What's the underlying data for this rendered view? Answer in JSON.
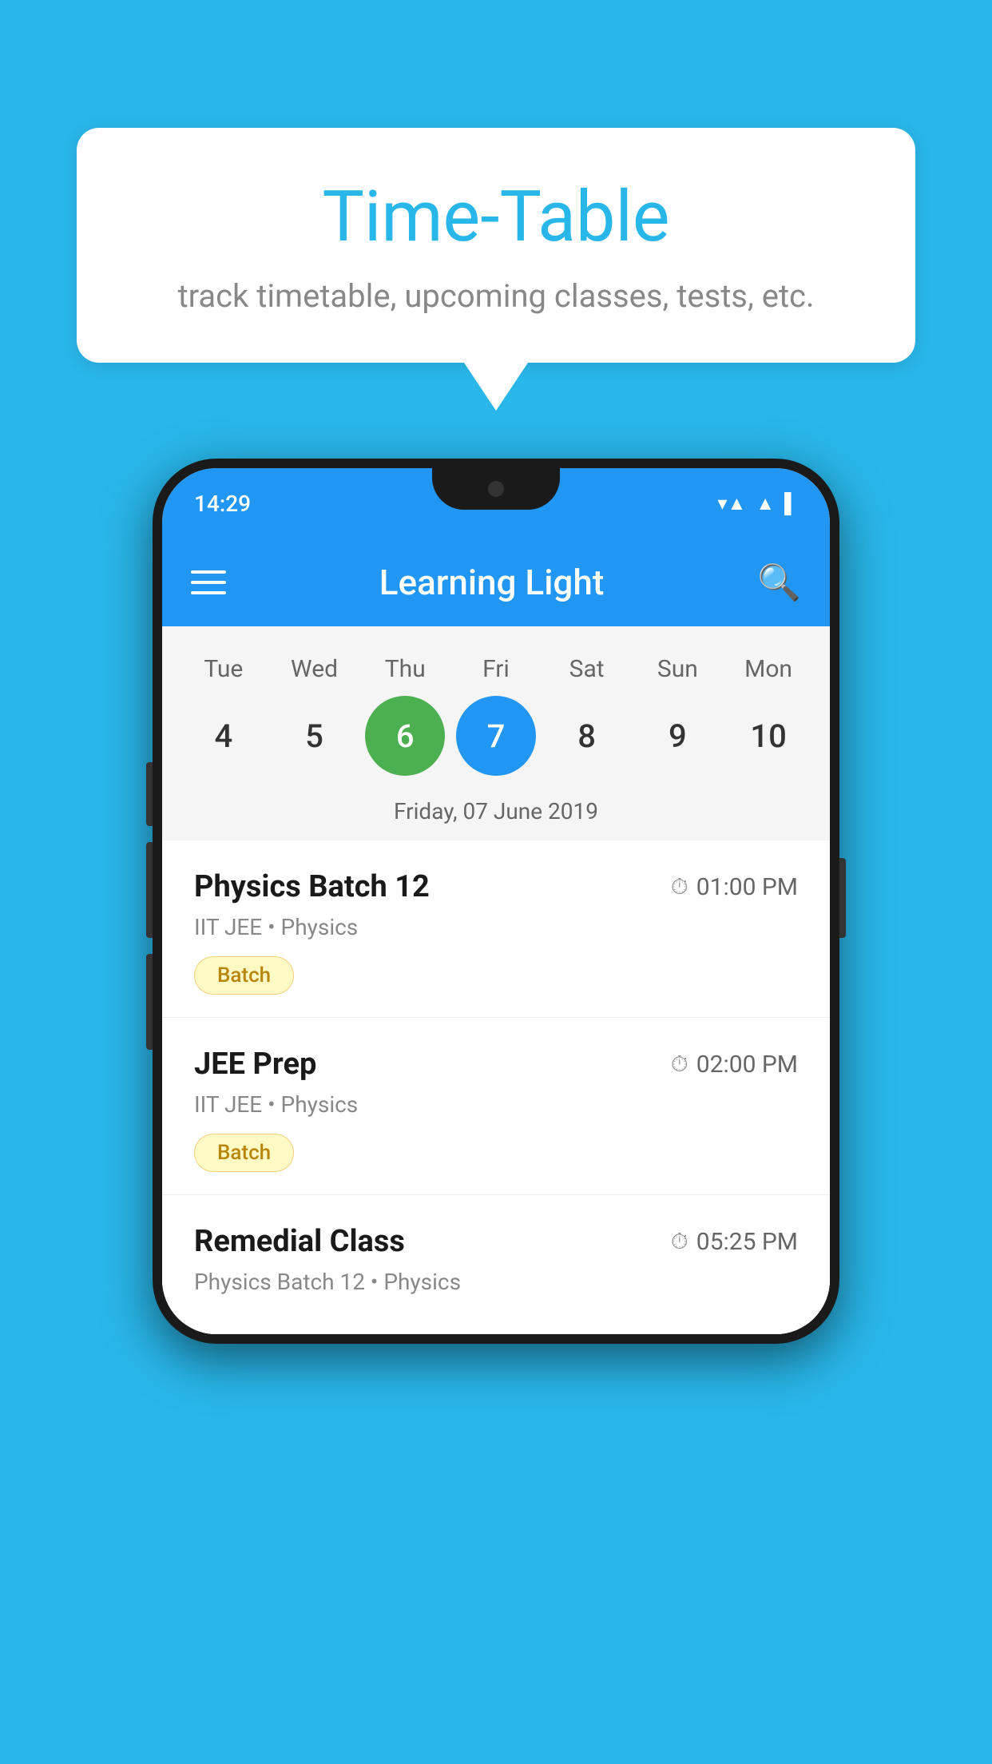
{
  "background_color": "#29B6E8",
  "bubble": {
    "title": "Time-Table",
    "subtitle": "track timetable, upcoming classes, tests, etc."
  },
  "app": {
    "status_time": "14:29",
    "title": "Learning Light"
  },
  "calendar": {
    "days": [
      {
        "name": "Tue",
        "num": "4",
        "state": "normal"
      },
      {
        "name": "Wed",
        "num": "5",
        "state": "normal"
      },
      {
        "name": "Thu",
        "num": "6",
        "state": "today"
      },
      {
        "name": "Fri",
        "num": "7",
        "state": "selected"
      },
      {
        "name": "Sat",
        "num": "8",
        "state": "normal"
      },
      {
        "name": "Sun",
        "num": "9",
        "state": "normal"
      },
      {
        "name": "Mon",
        "num": "10",
        "state": "normal"
      }
    ],
    "selected_date_label": "Friday, 07 June 2019"
  },
  "schedule": [
    {
      "title": "Physics Batch 12",
      "time": "01:00 PM",
      "subtitle": "IIT JEE • Physics",
      "badge": "Batch"
    },
    {
      "title": "JEE Prep",
      "time": "02:00 PM",
      "subtitle": "IIT JEE • Physics",
      "badge": "Batch"
    },
    {
      "title": "Remedial Class",
      "time": "05:25 PM",
      "subtitle": "Physics Batch 12 • Physics",
      "badge": null
    }
  ]
}
